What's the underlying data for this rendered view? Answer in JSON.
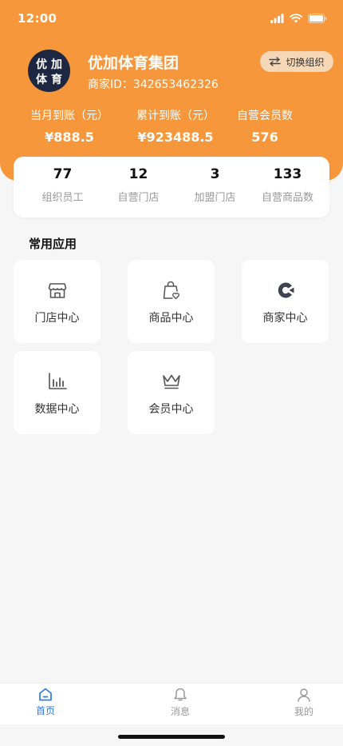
{
  "status_bar": {
    "time": "12:00"
  },
  "org": {
    "logo_text": [
      "优",
      "加",
      "体",
      "育"
    ],
    "name": "优加体育集团",
    "id_label": "商家ID：",
    "id_value": "342653462326",
    "switch_label": "切换组织"
  },
  "revenue": [
    {
      "label": "当月到账（元）",
      "value": "¥888.5"
    },
    {
      "label": "累计到账（元）",
      "value": "¥923488.5"
    },
    {
      "label": "自营会员数",
      "value": "576"
    }
  ],
  "counts": [
    {
      "value": "77",
      "label": "组织员工"
    },
    {
      "value": "12",
      "label": "自营门店"
    },
    {
      "value": "3",
      "label": "加盟门店"
    },
    {
      "value": "133",
      "label": "自营商品数"
    }
  ],
  "section_title": "常用应用",
  "apps": [
    {
      "label": "门店中心",
      "icon": "store-icon"
    },
    {
      "label": "商品中心",
      "icon": "shopping-bag-icon"
    },
    {
      "label": "商家中心",
      "icon": "merchant-icon"
    },
    {
      "label": "数据中心",
      "icon": "bar-chart-icon"
    },
    {
      "label": "会员中心",
      "icon": "crown-icon"
    }
  ],
  "tabbar": [
    {
      "label": "首页",
      "icon": "home-icon",
      "active": true
    },
    {
      "label": "消息",
      "icon": "bell-icon",
      "active": false
    },
    {
      "label": "我的",
      "icon": "user-icon",
      "active": false
    }
  ],
  "colors": {
    "header": "#f5973a",
    "accent": "#2e7ce4",
    "logo_bg": "#1d2742"
  }
}
